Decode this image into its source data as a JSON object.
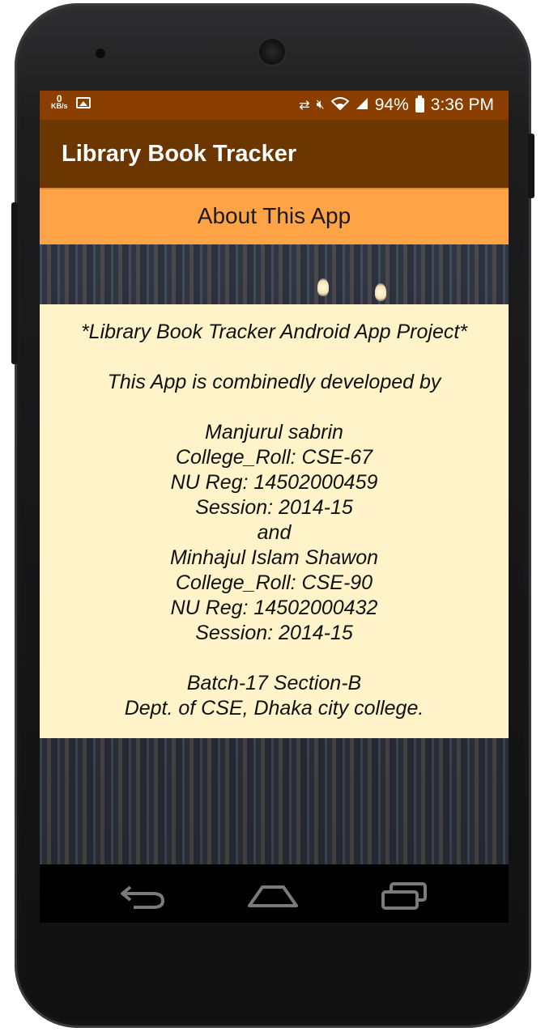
{
  "status_bar": {
    "net_speed_value": "0",
    "net_speed_unit": "KB/s",
    "gallery_icon": "image-icon",
    "battery": "94%",
    "time": "3:36 PM"
  },
  "app_bar": {
    "title": "Library Book Tracker"
  },
  "heading": {
    "label": "About This App"
  },
  "about": {
    "lines": [
      "*Library Book Tracker Android App Project*",
      "",
      "This App is combinedly developed by",
      "",
      "Manjurul sabrin",
      "College_Roll: CSE-67",
      "NU Reg: 14502000459",
      "Session: 2014-15",
      "and",
      "Minhajul Islam Shawon",
      "College_Roll: CSE-90",
      "NU Reg: 14502000432",
      "Session: 2014-15",
      "",
      "Batch-17 Section-B",
      "Dept. of CSE, Dhaka city college."
    ]
  },
  "nav_bar": {
    "back_icon": "back-icon",
    "home_icon": "home-icon",
    "recents_icon": "recents-icon"
  },
  "colors": {
    "status_bar": "#8a3e00",
    "app_bar": "#6b3600",
    "heading_bar": "#ffa347",
    "about_panel": "#fff3c9"
  }
}
